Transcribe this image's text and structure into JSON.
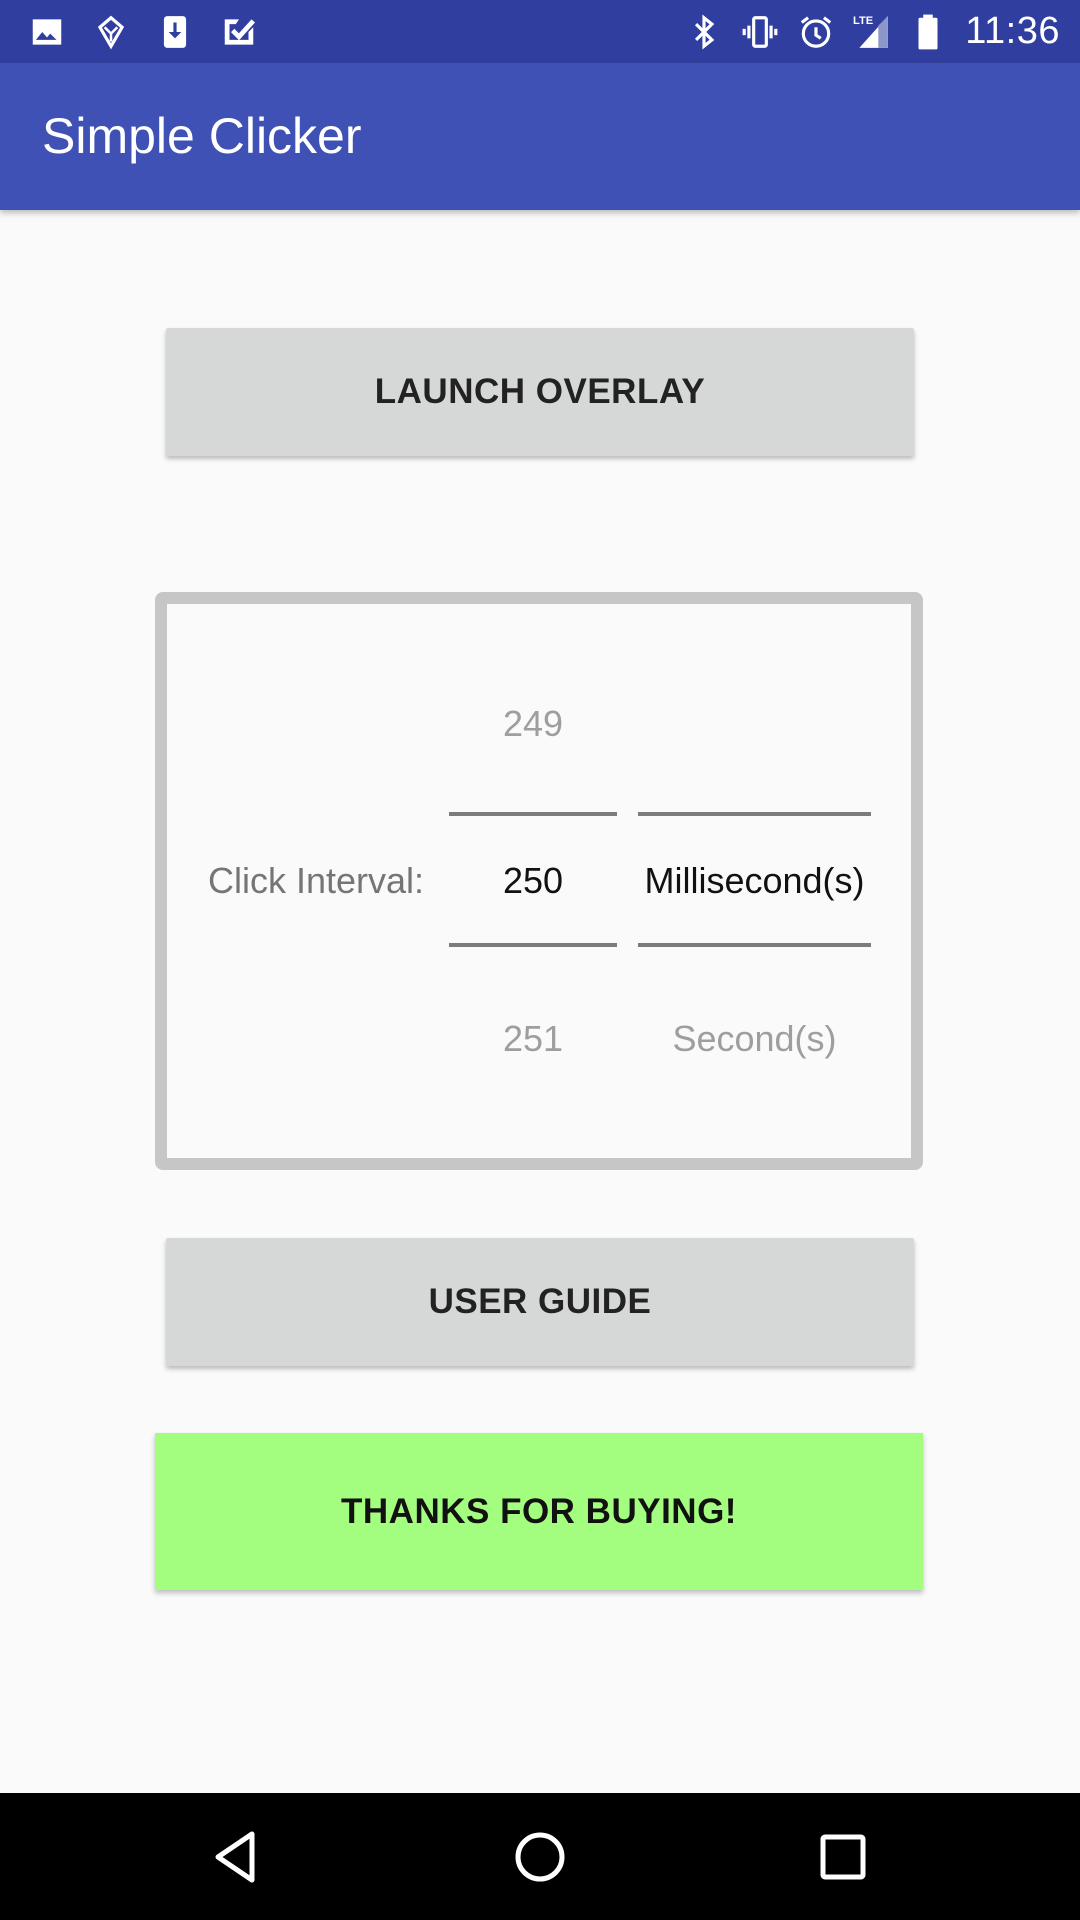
{
  "status_bar": {
    "time": "11:36",
    "left_icons": [
      "image-icon",
      "app-icon",
      "download-icon",
      "checkmark-icon"
    ],
    "right_icons": [
      "bluetooth-icon",
      "vibrate-icon",
      "alarm-icon",
      "lte-signal-icon",
      "battery-icon"
    ],
    "color": "#303f9f"
  },
  "app_bar": {
    "title": "Simple Clicker",
    "color": "#3f51b5"
  },
  "buttons": {
    "launch_overlay": "LAUNCH OVERLAY",
    "user_guide": "USER GUIDE",
    "thanks": "THANKS FOR BUYING!",
    "thanks_color": "#a3fd7e"
  },
  "picker": {
    "label": "Click Interval:",
    "number": {
      "previous": "249",
      "current": "250",
      "next": "251"
    },
    "unit": {
      "current": "Millisecond(s)",
      "next": "Second(s)"
    }
  },
  "nav_bar": {
    "icons": [
      "back-icon",
      "home-icon",
      "recents-icon"
    ]
  }
}
